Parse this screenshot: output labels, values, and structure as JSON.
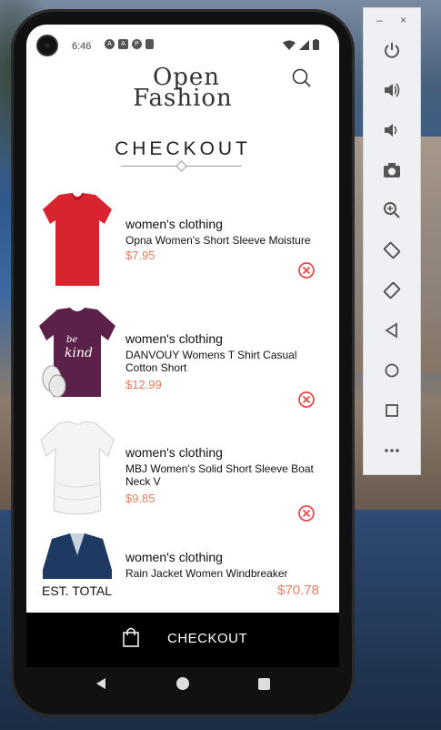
{
  "status": {
    "time": "6:46"
  },
  "app": {
    "logo_line1": "Open",
    "logo_line2": "Fashion",
    "page_title": "CHECKOUT"
  },
  "items": [
    {
      "category": "women's clothing",
      "name": "Opna Women's Short Sleeve Moisture",
      "price": "$7.95",
      "shirt_color": "#d9232f"
    },
    {
      "category": "women's clothing",
      "name": "DANVOUY Womens T Shirt Casual Cotton Short",
      "price": "$12.99",
      "shirt_color": "#5b2148"
    },
    {
      "category": "women's clothing",
      "name": "MBJ Women's Solid Short Sleeve Boat Neck V",
      "price": "$9.85",
      "shirt_color": "#f2f2f2"
    },
    {
      "category": "women's clothing",
      "name": "Rain Jacket Women Windbreaker",
      "price": "",
      "shirt_color": "#1f3a62"
    }
  ],
  "footer": {
    "est_total_label": "EST. TOTAL",
    "est_total_value": "$70.78",
    "checkout_label": "CHECKOUT"
  },
  "colors": {
    "accent": "#e27d60",
    "remove_icon": "#e34b4b"
  },
  "emulator_panel": {
    "minimize_label": "–",
    "close_label": "×"
  }
}
